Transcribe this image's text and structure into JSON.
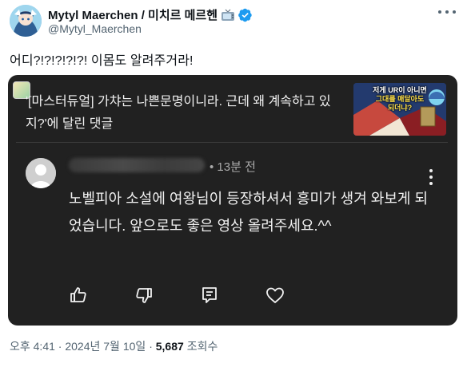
{
  "tweet": {
    "display_name": "Mytyl Maerchen / 미치르 메르헨",
    "handle": "@Mytyl_Maerchen",
    "text": "어디?!?!?!?!?! 이몸도 알려주거라!",
    "time": "오후 4:41",
    "date": "2024년 7월 10일",
    "separator": "·",
    "views_count": "5,687",
    "views_label": "조회수"
  },
  "embedded": {
    "title": "'[마스터듀얼] 가챠는 나쁜문명이니라. 근데 왜 계속하고 있지?'에 달린 댓글",
    "thumbnail_caption_line1": "저게 UR이 아니면",
    "thumbnail_caption_line2": "그대를 매달아도",
    "thumbnail_caption_line3": "되더냐?",
    "comment": {
      "meta": "• 13분 전",
      "body": "노벨피아 소설에 여왕님이 등장하셔서 흥미가 생겨 와보게 되었습니다. 앞으로도 좋은 영상 올려주세요.^^"
    }
  },
  "icons": {
    "more": "more-horizontal-icon",
    "verified": "verified-badge-icon",
    "tv": "tv-emoji-icon",
    "like": "thumbs-up-icon",
    "dislike": "thumbs-down-icon",
    "reply": "reply-comment-icon",
    "heart": "heart-icon",
    "kebab": "more-vertical-icon"
  },
  "colors": {
    "verified": "#1d9bf0",
    "card_background": "#212121",
    "text_secondary": "#536471"
  }
}
